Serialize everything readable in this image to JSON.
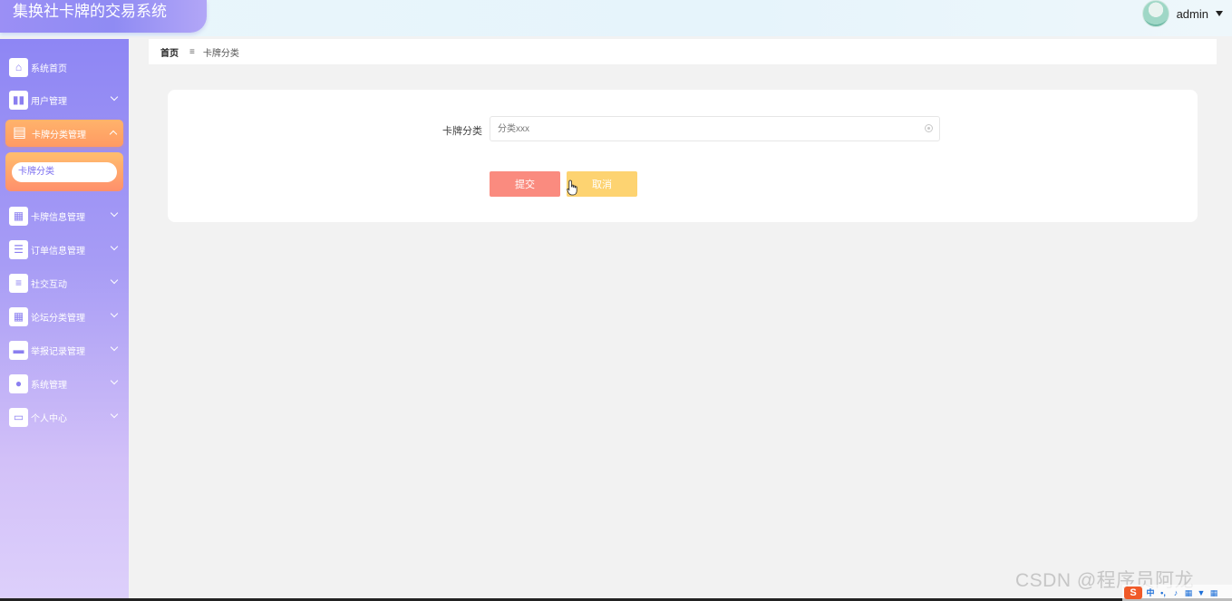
{
  "app": {
    "title": "集换社卡牌的交易系统"
  },
  "user": {
    "name": "admin"
  },
  "sidebar": {
    "items": [
      {
        "label": "系统首页",
        "icon": "home-icon"
      },
      {
        "label": "用户管理",
        "icon": "book-icon"
      },
      {
        "label": "卡牌分类管理",
        "icon": "clipboard-icon",
        "active": true,
        "sub": [
          {
            "label": "卡牌分类"
          }
        ]
      },
      {
        "label": "卡牌信息管理",
        "icon": "grid-icon"
      },
      {
        "label": "订单信息管理",
        "icon": "sliders-icon"
      },
      {
        "label": "社交互动",
        "icon": "list-icon"
      },
      {
        "label": "论坛分类管理",
        "icon": "grid-icon"
      },
      {
        "label": "举报记录管理",
        "icon": "tray-icon"
      },
      {
        "label": "系统管理",
        "icon": "user-icon"
      },
      {
        "label": "个人中心",
        "icon": "card-icon"
      }
    ]
  },
  "breadcrumb": {
    "home": "首页",
    "separator": "≡",
    "current": "卡牌分类"
  },
  "form": {
    "field_label": "卡牌分类",
    "field_placeholder": "分类xxx",
    "submit_label": "提交",
    "cancel_label": "取消"
  },
  "watermark": "CSDN @程序员阿龙",
  "tray": {
    "logo": "S",
    "ime": "中"
  },
  "colors": {
    "accent": "#8e86f4",
    "active": "#ff9a63",
    "submit": "#fa8b7f",
    "cancel": "#fdd371"
  }
}
